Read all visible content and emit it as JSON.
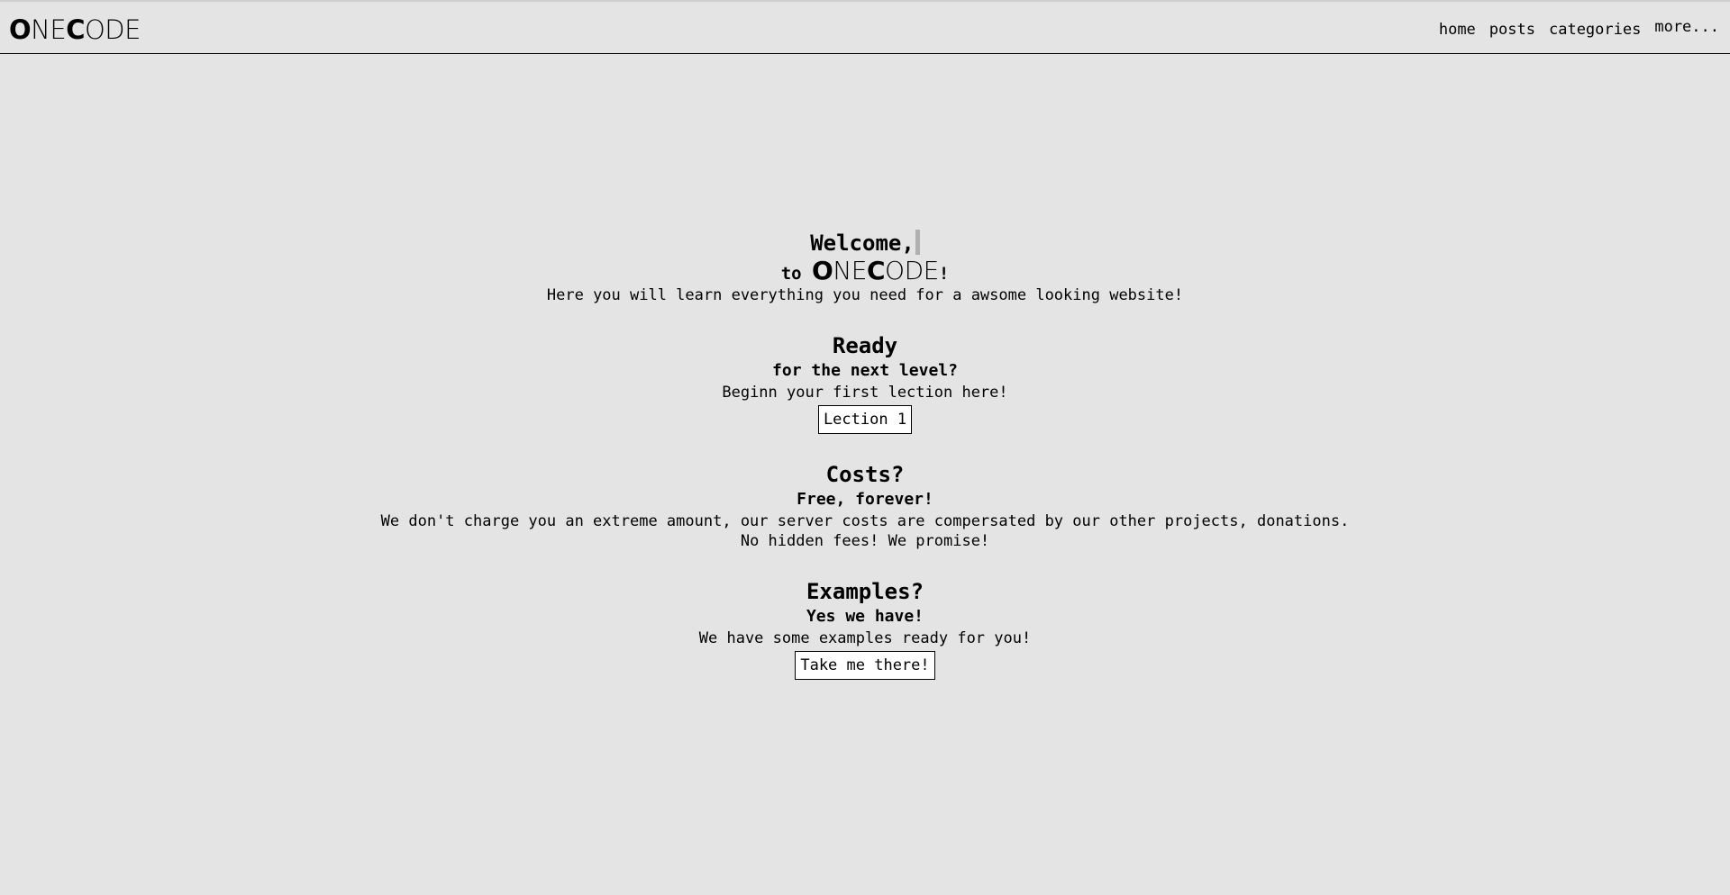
{
  "nav": {
    "logo": {
      "o": "O",
      "ne": "NE",
      "c": "C",
      "ode": "ODE"
    },
    "links": {
      "home": "home",
      "posts": "posts",
      "categories": "categories",
      "more": "more..."
    }
  },
  "hero": {
    "welcome": "Welcome,",
    "to_prefix": "to ",
    "to_suffix": "!",
    "description": "Here you will learn everything you need for a awsome looking website!"
  },
  "ready": {
    "title": "Ready",
    "subtitle": "for the next level?",
    "text": "Beginn your first lection here!",
    "button": "Lection 1"
  },
  "costs": {
    "title": "Costs?",
    "subtitle": "Free, forever!",
    "text1": "We don't charge you an extreme amount, our server costs are compersated by our other projects, donations.",
    "text2": "No hidden fees! We promise!"
  },
  "examples": {
    "title": "Examples?",
    "subtitle": "Yes we have!",
    "text": "We have some examples ready for you!",
    "button": "Take me there!"
  }
}
